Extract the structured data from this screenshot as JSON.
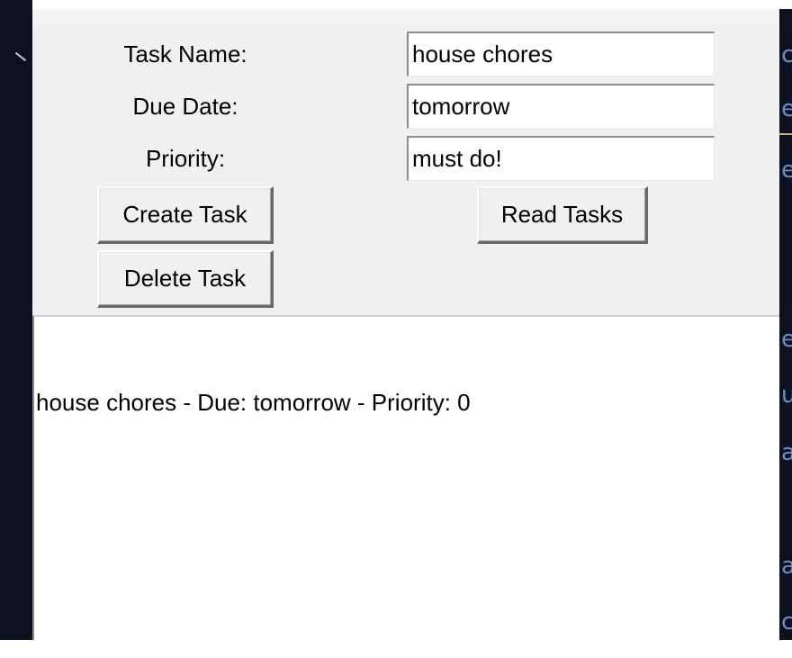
{
  "form": {
    "task_name_label": "Task Name:",
    "task_name_value": "house chores",
    "due_date_label": "Due Date:",
    "due_date_value": "tomorrow",
    "priority_label": "Priority:",
    "priority_value": "must do!"
  },
  "buttons": {
    "create_label": "Create Task",
    "read_label": "Read Tasks",
    "delete_label": "Delete Task"
  },
  "output": {
    "lines": [
      "house chores - Due: tomorrow - Priority: 0"
    ]
  },
  "background_fragments": [
    "c",
    "e",
    "e",
    "e",
    "u",
    "a",
    "a",
    "c"
  ],
  "colors": {
    "editor_bg": "#0e1220",
    "window_bg": "#f0f0f0",
    "fragment_text": "#6c8fc9"
  }
}
